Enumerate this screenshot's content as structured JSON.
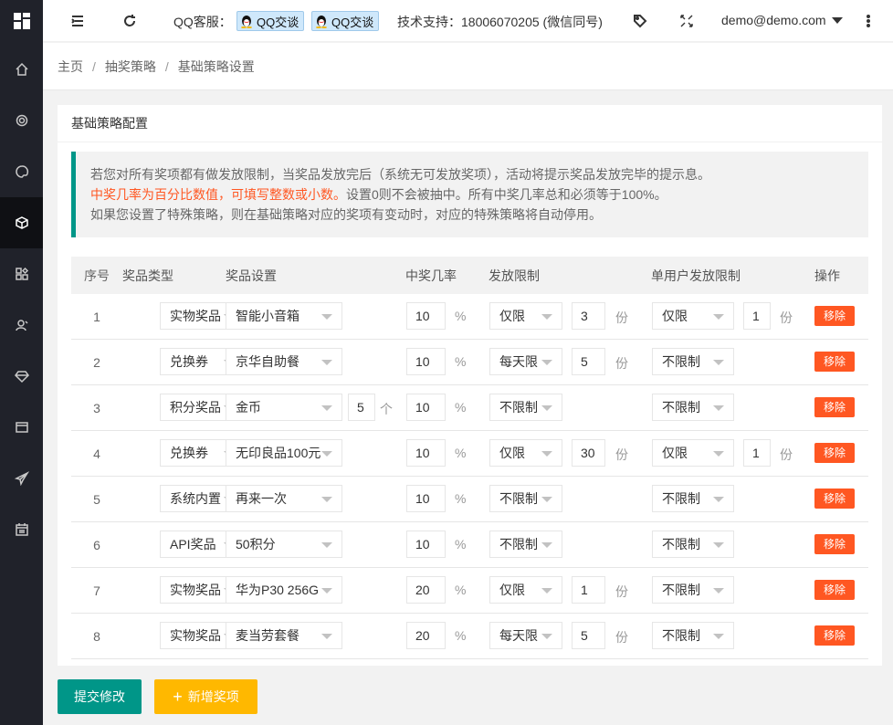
{
  "header": {
    "qq_label": "QQ客服：",
    "qq_badges": [
      "QQ交谈",
      "QQ交谈"
    ],
    "support": "技术支持：18006070205 (微信同号)",
    "user": "demo@demo.com"
  },
  "breadcrumb": [
    "主页",
    "抽奖策略",
    "基础策略设置"
  ],
  "card_title": "基础策略配置",
  "notice": {
    "line1": "若您对所有奖项都有做发放限制，当奖品发放完后（系统无可发放奖项），活动将提示奖品发放完毕的提示息。",
    "line2_red": "中奖几率为百分比数值，可填写整数或小数。",
    "line2_rest": "设置0则不会被抽中。所有中奖几率总和必须等于100%。",
    "line3": "如果您设置了特殊策略，则在基础策略对应的奖项有变动时，对应的特殊策略将自动停用。"
  },
  "table": {
    "headers": [
      "序号",
      "奖品类型",
      "奖品设置",
      "中奖几率",
      "发放限制",
      "单用户发放限制",
      "操作"
    ],
    "percent_unit": "%",
    "unit_fen": "份",
    "unit_ge": "个",
    "remove_label": "移除",
    "rows": [
      {
        "idx": "1",
        "type": "实物奖品",
        "prize": "智能小音箱",
        "extra": "",
        "rate": "10",
        "limit": "仅限",
        "limit_qty": "3",
        "user_limit": "仅限",
        "user_qty": "1"
      },
      {
        "idx": "2",
        "type": "兑换券",
        "prize": "京华自助餐",
        "extra": "",
        "rate": "10",
        "limit": "每天限",
        "limit_qty": "5",
        "user_limit": "不限制",
        "user_qty": ""
      },
      {
        "idx": "3",
        "type": "积分奖品",
        "prize": "金币",
        "extra": "5",
        "rate": "10",
        "limit": "不限制",
        "limit_qty": "",
        "user_limit": "不限制",
        "user_qty": ""
      },
      {
        "idx": "4",
        "type": "兑换券",
        "prize": "无印良品100元",
        "extra": "",
        "rate": "10",
        "limit": "仅限",
        "limit_qty": "30",
        "user_limit": "仅限",
        "user_qty": "1"
      },
      {
        "idx": "5",
        "type": "系统内置",
        "prize": "再来一次",
        "extra": "",
        "rate": "10",
        "limit": "不限制",
        "limit_qty": "",
        "user_limit": "不限制",
        "user_qty": ""
      },
      {
        "idx": "6",
        "type": "API奖品",
        "prize": "50积分",
        "extra": "",
        "rate": "10",
        "limit": "不限制",
        "limit_qty": "",
        "user_limit": "不限制",
        "user_qty": ""
      },
      {
        "idx": "7",
        "type": "实物奖品",
        "prize": "华为P30 256G",
        "extra": "",
        "rate": "20",
        "limit": "仅限",
        "limit_qty": "1",
        "user_limit": "不限制",
        "user_qty": ""
      },
      {
        "idx": "8",
        "type": "实物奖品",
        "prize": "麦当劳套餐",
        "extra": "",
        "rate": "20",
        "limit": "每天限",
        "limit_qty": "5",
        "user_limit": "不限制",
        "user_qty": ""
      }
    ]
  },
  "buttons": {
    "submit": "提交修改",
    "add": "新增奖项"
  },
  "colors": {
    "sidebar": "#20222a",
    "primary": "#009688",
    "danger": "#ff5722",
    "warm": "#ffb800"
  }
}
